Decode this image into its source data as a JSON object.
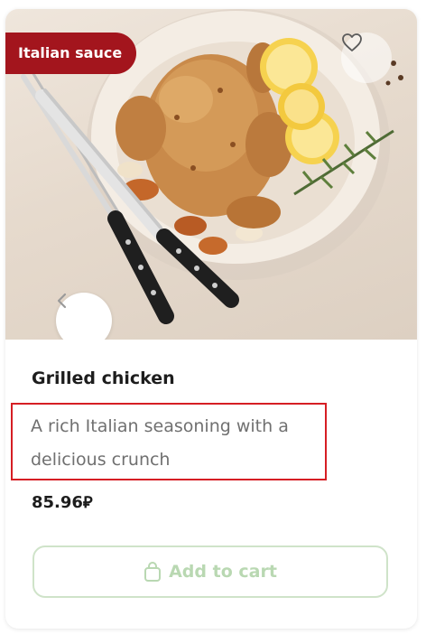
{
  "product": {
    "badge": "Italian sauce",
    "title": "Grilled chicken",
    "description": "A rich Italian seasoning with a delicious crunch",
    "price": "85.96⃁",
    "add_to_cart_label": "Add to cart",
    "favorite_icon": "heart-outline-icon",
    "prev_icon": "chevron-left-icon",
    "cart_icon": "shopping-bag-icon"
  },
  "colors": {
    "badge_bg": "#a3151d",
    "highlight_border": "#d61e24",
    "cart_button_text": "#b9d8b2",
    "cart_button_border": "#cfe3c9"
  }
}
